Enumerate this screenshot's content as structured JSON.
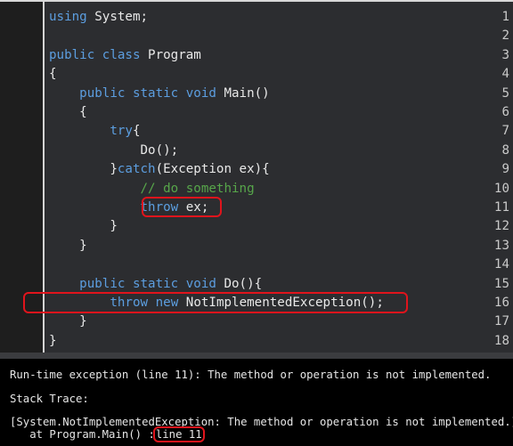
{
  "editor": {
    "lines": [
      {
        "n": "1",
        "tokens": [
          {
            "t": "using",
            "c": "kw"
          },
          {
            "t": " System;",
            "c": "pl"
          }
        ]
      },
      {
        "n": "2",
        "tokens": []
      },
      {
        "n": "3",
        "tokens": [
          {
            "t": "public",
            "c": "kw"
          },
          {
            "t": " ",
            "c": "pl"
          },
          {
            "t": "class",
            "c": "kw"
          },
          {
            "t": " Program",
            "c": "pl"
          }
        ]
      },
      {
        "n": "4",
        "tokens": [
          {
            "t": "{",
            "c": "pl"
          }
        ]
      },
      {
        "n": "5",
        "tokens": [
          {
            "t": "    ",
            "c": "pl"
          },
          {
            "t": "public",
            "c": "kw"
          },
          {
            "t": " ",
            "c": "pl"
          },
          {
            "t": "static",
            "c": "kw"
          },
          {
            "t": " ",
            "c": "pl"
          },
          {
            "t": "void",
            "c": "kw"
          },
          {
            "t": " Main()",
            "c": "pl"
          }
        ]
      },
      {
        "n": "6",
        "tokens": [
          {
            "t": "    {",
            "c": "pl"
          }
        ]
      },
      {
        "n": "7",
        "tokens": [
          {
            "t": "        ",
            "c": "pl"
          },
          {
            "t": "try",
            "c": "kw"
          },
          {
            "t": "{",
            "c": "pl"
          }
        ]
      },
      {
        "n": "8",
        "tokens": [
          {
            "t": "            Do();",
            "c": "pl"
          }
        ]
      },
      {
        "n": "9",
        "tokens": [
          {
            "t": "        }",
            "c": "pl"
          },
          {
            "t": "catch",
            "c": "kw"
          },
          {
            "t": "(Exception ex){",
            "c": "pl"
          }
        ]
      },
      {
        "n": "10",
        "tokens": [
          {
            "t": "            ",
            "c": "pl"
          },
          {
            "t": "// do something",
            "c": "cm"
          }
        ]
      },
      {
        "n": "11",
        "tokens": [
          {
            "t": "            ",
            "c": "pl"
          },
          {
            "t": "throw",
            "c": "kw"
          },
          {
            "t": " ex;",
            "c": "pl"
          }
        ]
      },
      {
        "n": "12",
        "tokens": [
          {
            "t": "        }",
            "c": "pl"
          }
        ]
      },
      {
        "n": "13",
        "tokens": [
          {
            "t": "    }",
            "c": "pl"
          }
        ]
      },
      {
        "n": "14",
        "tokens": []
      },
      {
        "n": "15",
        "tokens": [
          {
            "t": "    ",
            "c": "pl"
          },
          {
            "t": "public",
            "c": "kw"
          },
          {
            "t": " ",
            "c": "pl"
          },
          {
            "t": "static",
            "c": "kw"
          },
          {
            "t": " ",
            "c": "pl"
          },
          {
            "t": "void",
            "c": "kw"
          },
          {
            "t": " Do(){",
            "c": "pl"
          }
        ]
      },
      {
        "n": "16",
        "tokens": [
          {
            "t": "        ",
            "c": "pl"
          },
          {
            "t": "throw",
            "c": "kw"
          },
          {
            "t": " ",
            "c": "pl"
          },
          {
            "t": "new",
            "c": "kw"
          },
          {
            "t": " NotImplementedException();",
            "c": "pl"
          }
        ]
      },
      {
        "n": "17",
        "tokens": [
          {
            "t": "    }",
            "c": "pl"
          }
        ]
      },
      {
        "n": "18",
        "tokens": [
          {
            "t": "}",
            "c": "pl"
          }
        ]
      }
    ]
  },
  "console": {
    "error_line": "Run-time exception (line 11): The method or operation is not implemented.",
    "stack_label": "Stack Trace:",
    "exception_line": "[System.NotImplementedException: The method or operation is not implemented.]",
    "at_prefix": "   at Program.Main() :",
    "at_line": "line 11"
  },
  "colors": {
    "keyword": "#5c9ee0",
    "comment": "#57a64a",
    "highlight": "#e0141c"
  }
}
